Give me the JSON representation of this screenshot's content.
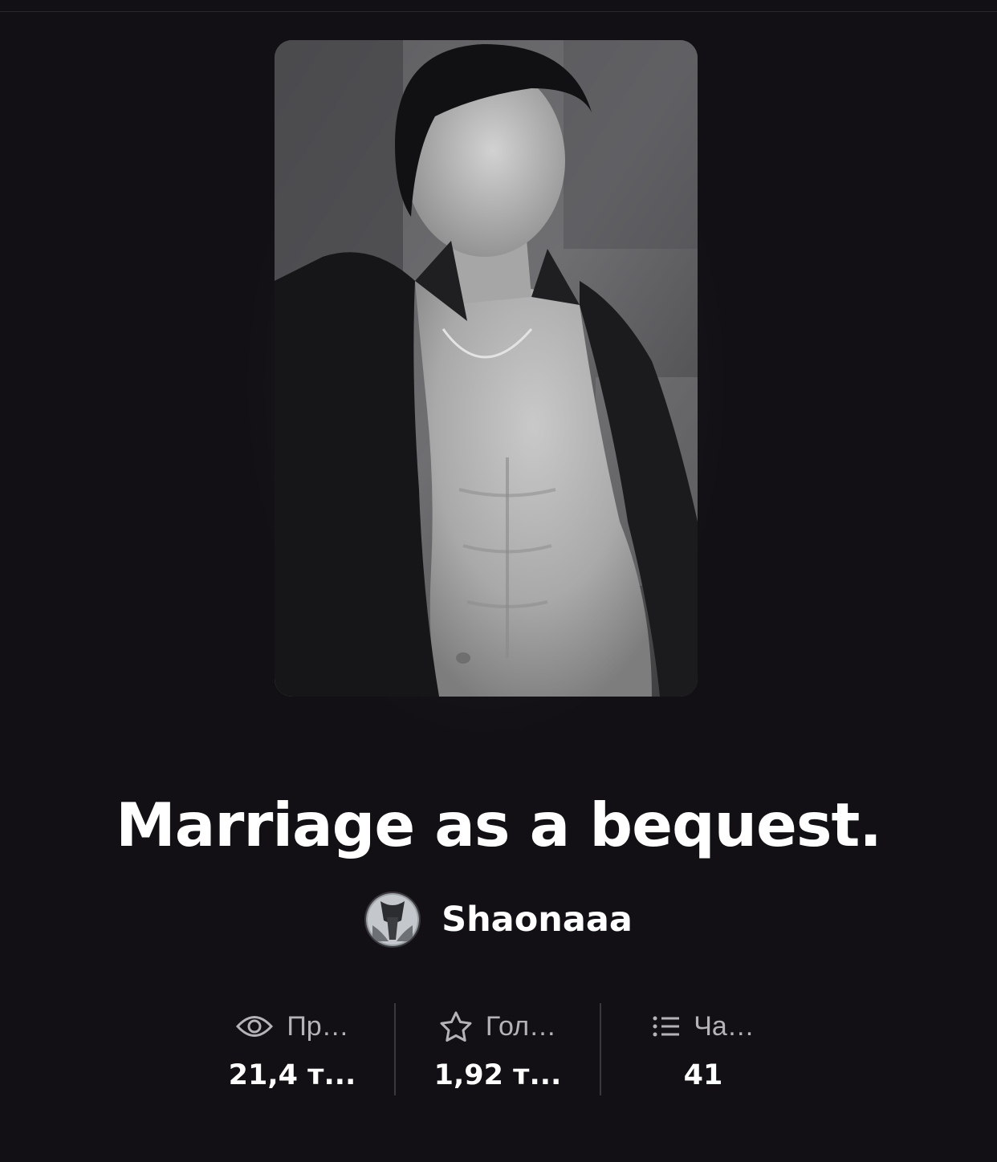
{
  "story": {
    "title": "Marriage as a bequest.",
    "author": "Shaonaaa"
  },
  "stats": [
    {
      "icon": "eye-icon",
      "label": "Пр…",
      "value": "21,4 т..."
    },
    {
      "icon": "star-icon",
      "label": "Гол…",
      "value": "1,92 т..."
    },
    {
      "icon": "list-icon",
      "label": "Ча…",
      "value": "41"
    }
  ],
  "colors": {
    "background": "#121014",
    "text": "#ffffff",
    "muted": "#b5b3b8",
    "divider": "#3a383d"
  }
}
